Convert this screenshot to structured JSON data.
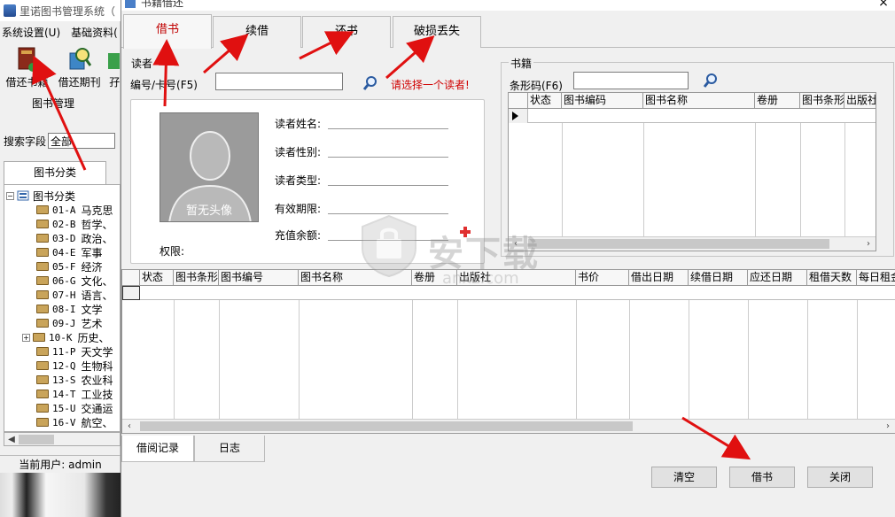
{
  "main_window": {
    "title": "里诺图书管理系统（",
    "menu": [
      "系统设置(U)",
      "基础资料("
    ],
    "toolbar": [
      "借还书籍",
      "借还期刊",
      "孖"
    ],
    "section_title": "图书管理",
    "search_label": "搜索字段",
    "search_value": "全部",
    "tab": "图书分类",
    "tree_root": "图书分类",
    "tree_items": [
      {
        "code": "01-A",
        "name": "马克思"
      },
      {
        "code": "02-B",
        "name": "哲学、"
      },
      {
        "code": "03-D",
        "name": "政治、"
      },
      {
        "code": "04-E",
        "name": "军事"
      },
      {
        "code": "05-F",
        "name": "经济"
      },
      {
        "code": "06-G",
        "name": "文化、"
      },
      {
        "code": "07-H",
        "name": "语言、"
      },
      {
        "code": "08-I",
        "name": "文学"
      },
      {
        "code": "09-J",
        "name": "艺术"
      },
      {
        "code": "10-K",
        "name": "历史、"
      },
      {
        "code": "11-P",
        "name": "天文学"
      },
      {
        "code": "12-Q",
        "name": "生物科"
      },
      {
        "code": "13-S",
        "name": "农业科"
      },
      {
        "code": "14-T",
        "name": "工业技"
      },
      {
        "code": "15-U",
        "name": "交通运"
      },
      {
        "code": "16-V",
        "name": "航空、"
      }
    ],
    "status": "当前用户: admin"
  },
  "dialog": {
    "title": "书籍借还",
    "tabs": [
      "借书",
      "续借",
      "还书",
      "破损丢失"
    ],
    "reader": {
      "group_title": "读者",
      "id_label": "编号/卡号(F5)",
      "id_value": "",
      "warning": "请选择一个读者!",
      "avatar_text": "暂无头像",
      "permission_label": "权限:",
      "fields": [
        "读者姓名:",
        "读者性别:",
        "读者类型:",
        "有效期限:",
        "充值余额:"
      ]
    },
    "book": {
      "group_title": "书籍",
      "barcode_label": "条形码(F6)",
      "barcode_value": "",
      "columns": [
        "状态",
        "图书编码",
        "图书名称",
        "卷册",
        "图书条形",
        "出版社"
      ]
    },
    "borrow_grid_columns": [
      "状态",
      "图书条形",
      "图书编号",
      "图书名称",
      "卷册",
      "出版社",
      "书价",
      "借出日期",
      "续借日期",
      "应还日期",
      "租借天数",
      "每日租金"
    ],
    "bottom_tabs": [
      "借阅记录",
      "日志"
    ],
    "buttons": {
      "clear": "清空",
      "borrow": "借书",
      "close": "关闭"
    },
    "close_glyph": "×"
  },
  "watermark": {
    "text": "安下载",
    "sub": "anxz.com"
  },
  "colors": {
    "accent_red": "#d00000",
    "arrow_red": "#e01010"
  }
}
